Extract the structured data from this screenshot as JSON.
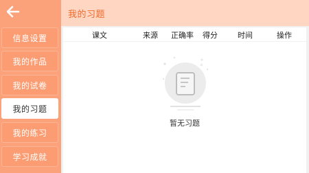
{
  "header": {
    "title": "我的习题"
  },
  "sidebar": {
    "items": [
      {
        "label": "信息设置"
      },
      {
        "label": "我的作品"
      },
      {
        "label": "我的试卷"
      },
      {
        "label": "我的习题",
        "active": true
      },
      {
        "label": "我的练习"
      },
      {
        "label": "学习成就"
      }
    ]
  },
  "table": {
    "columns": [
      "课文",
      "来源",
      "正确率",
      "得分",
      "时间",
      "操作"
    ]
  },
  "empty_state": {
    "text": "暂无习题",
    "icon": "empty-document-icon"
  },
  "colors": {
    "sidebar": "#fba27a",
    "topbar": "#fed6c2",
    "accent": "#f06a2c"
  }
}
